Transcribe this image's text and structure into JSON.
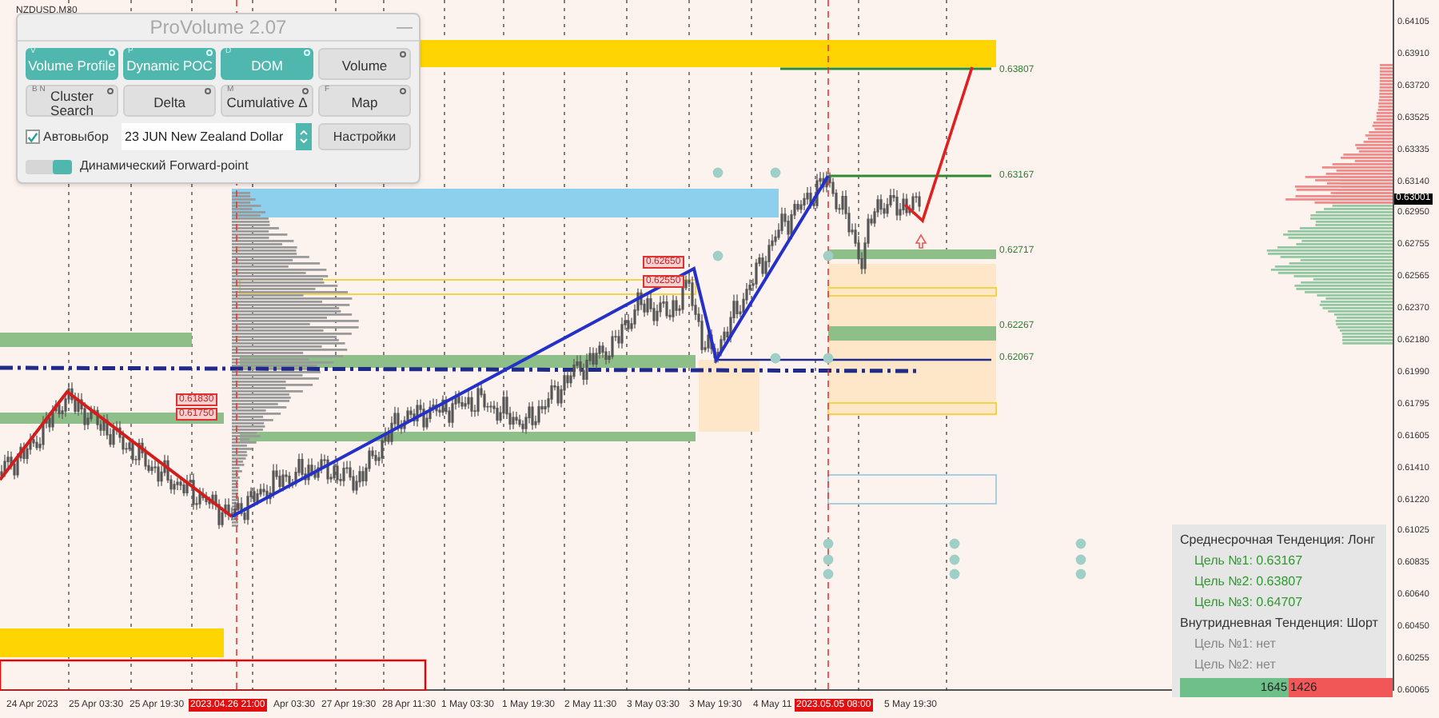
{
  "symbol": "NZDUSD,M30",
  "panel": {
    "title": "ProVolume 2.07",
    "minimize": "—",
    "buttons": [
      {
        "label": "Volume Profile",
        "hotkey": "V",
        "on": true
      },
      {
        "label": "Dynamic POC",
        "hotkey": "P",
        "on": true
      },
      {
        "label": "DOM",
        "hotkey": "D",
        "on": true
      },
      {
        "label": "Volume",
        "on": false
      },
      {
        "label": "Cluster Search",
        "hotkey": "B N",
        "on": false
      },
      {
        "label": "Delta",
        "on": false
      },
      {
        "label": "Cumulative Δ",
        "hotkey": "M",
        "on": false
      },
      {
        "label": "Map",
        "hotkey": "F",
        "on": false
      }
    ],
    "auto_select": {
      "label": "Автовыбор",
      "checked": true
    },
    "instrument": {
      "value": "23 JUN New Zealand Dollar"
    },
    "settings_button": "Настройки",
    "forward_point": {
      "label": "Динамический Forward-point",
      "on": true
    }
  },
  "chart": {
    "level_labels": [
      "0.63807",
      "0.63167",
      "0.62717",
      "0.62267",
      "0.62067"
    ],
    "price_tags": [
      "0.62650",
      "0.62550",
      "0.61830",
      "0.61750"
    ]
  },
  "price_axis": {
    "ticks": [
      "0.64105",
      "0.63910",
      "0.63720",
      "0.63525",
      "0.63335",
      "0.63140",
      "0.62950",
      "0.62755",
      "0.62565",
      "0.62370",
      "0.62180",
      "0.61990",
      "0.61795",
      "0.61605",
      "0.61410",
      "0.61220",
      "0.61025",
      "0.60835",
      "0.60640",
      "0.60450",
      "0.60255",
      "0.60065"
    ],
    "current": "0.63001"
  },
  "time_axis": [
    {
      "text": "24 Apr 2023",
      "kind": "normal"
    },
    {
      "text": "25 Apr 03:30",
      "kind": "normal"
    },
    {
      "text": "25 Apr 19:30",
      "kind": "normal"
    },
    {
      "text": "2023.04.26 21:00",
      "kind": "marker"
    },
    {
      "text": "Apr 03:30",
      "kind": "normal"
    },
    {
      "text": "27 Apr 19:30",
      "kind": "normal"
    },
    {
      "text": "28 Apr 11:30",
      "kind": "normal"
    },
    {
      "text": "1 May 03:30",
      "kind": "normal"
    },
    {
      "text": "1 May 19:30",
      "kind": "normal"
    },
    {
      "text": "2 May 11:30",
      "kind": "normal"
    },
    {
      "text": "3 May 03:30",
      "kind": "normal"
    },
    {
      "text": "3 May 19:30",
      "kind": "normal"
    },
    {
      "text": "4 May 11",
      "kind": "normal"
    },
    {
      "text": "2023.05.05 08:00",
      "kind": "marker"
    },
    {
      "text": "5 May 19:30",
      "kind": "normal"
    }
  ],
  "info_panel": {
    "lines": [
      {
        "text": "Среднесрочная Тенденция: Лонг",
        "kind": "header"
      },
      {
        "text": "Цель №1: 0.63167",
        "kind": "target"
      },
      {
        "text": "Цель №2: 0.63807",
        "kind": "target"
      },
      {
        "text": "Цель №3: 0.64707",
        "kind": "target"
      },
      {
        "text": "Внутридневная Тенденция: Шорт",
        "kind": "header"
      },
      {
        "text": "Цель №1: нет",
        "kind": "none"
      },
      {
        "text": "Цель №2: нет",
        "kind": "none"
      }
    ],
    "buy": "1645",
    "sell": "1426"
  }
}
